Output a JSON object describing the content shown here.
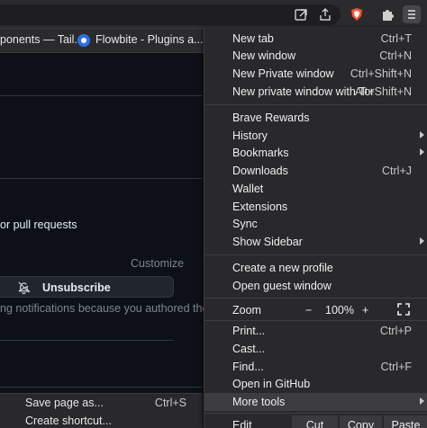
{
  "bookmarks": {
    "item1": "ponents — Tail...",
    "item2": "Flowbite - Plugins a..."
  },
  "page": {
    "line1": "or pull requests",
    "customize": "Customize",
    "unsubscribe": "Unsubscribe",
    "notice": "ng notifications because you authored the"
  },
  "submenu": {
    "items": [
      {
        "label": "Save page as...",
        "shortcut": "Ctrl+S"
      },
      {
        "label": "Create shortcut...",
        "shortcut": ""
      }
    ]
  },
  "menu": {
    "items": [
      {
        "label": "New tab",
        "shortcut": "Ctrl+T"
      },
      {
        "label": "New window",
        "shortcut": "Ctrl+N"
      },
      {
        "label": "New Private window",
        "shortcut": "Ctrl+Shift+N"
      },
      {
        "label": "New private window with Tor",
        "shortcut": "Alt+Shift+N"
      },
      {
        "label": "Brave Rewards",
        "shortcut": ""
      },
      {
        "label": "History",
        "shortcut": ""
      },
      {
        "label": "Bookmarks",
        "shortcut": ""
      },
      {
        "label": "Downloads",
        "shortcut": "Ctrl+J"
      },
      {
        "label": "Wallet",
        "shortcut": ""
      },
      {
        "label": "Extensions",
        "shortcut": ""
      },
      {
        "label": "Sync",
        "shortcut": ""
      },
      {
        "label": "Show Sidebar",
        "shortcut": ""
      },
      {
        "label": "Create a new profile",
        "shortcut": ""
      },
      {
        "label": "Open guest window",
        "shortcut": ""
      },
      {
        "label": "Print...",
        "shortcut": "Ctrl+P"
      },
      {
        "label": "Cast...",
        "shortcut": ""
      },
      {
        "label": "Find...",
        "shortcut": "Ctrl+F"
      },
      {
        "label": "Open in GitHub",
        "shortcut": ""
      },
      {
        "label": "More tools",
        "shortcut": ""
      }
    ],
    "zoom": {
      "label": "Zoom",
      "minus": "−",
      "value": "100%",
      "plus": "+"
    },
    "edit": {
      "label": "Edit",
      "cut": "Cut",
      "copy": "Copy",
      "paste": "Paste"
    }
  },
  "icons": {
    "toolbar": [
      "open-in-window-icon",
      "share-icon",
      "brave-shields-icon",
      "extensions-puzzle-icon",
      "menu-hamburger-icon"
    ],
    "unsubscribe": "bell-slash-icon",
    "fullscreen": "fullscreen-icon"
  },
  "colors": {
    "menu_bg": "#29292c",
    "page_bg": "#0d1117",
    "highlight": "#3d3d41",
    "brave_orange": "#fb542b"
  }
}
